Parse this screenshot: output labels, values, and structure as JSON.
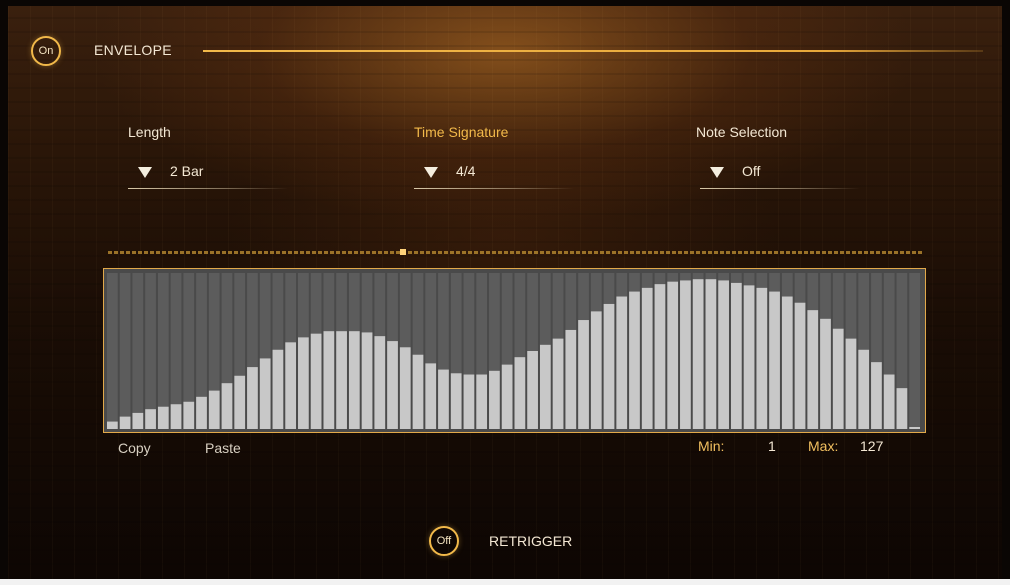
{
  "envelope": {
    "title": "ENVELOPE",
    "power": "On"
  },
  "controls": {
    "length": {
      "label": "Length",
      "value": "2 Bar"
    },
    "time_signature": {
      "label": "Time Signature",
      "value": "4/4"
    },
    "note_selection": {
      "label": "Note Selection",
      "value": "Off"
    }
  },
  "editor": {
    "copy_label": "Copy",
    "paste_label": "Paste",
    "min_label": "Min:",
    "min_value": "1",
    "max_label": "Max:",
    "max_value": "127",
    "current_step": 24,
    "step_count": 64
  },
  "retrigger": {
    "label": "RETRIGGER",
    "state": "Off"
  },
  "colors": {
    "accent": "#f2b94a",
    "bar": "#c8c8c8",
    "graph_bg": "#4a4a4a"
  },
  "chart_data": {
    "type": "bar",
    "y_range": [
      1,
      127
    ],
    "values": [
      7,
      11,
      14,
      17,
      19,
      21,
      23,
      27,
      32,
      38,
      44,
      51,
      58,
      65,
      71,
      75,
      78,
      80,
      80,
      80,
      79,
      76,
      72,
      67,
      61,
      54,
      49,
      46,
      45,
      45,
      48,
      53,
      59,
      64,
      69,
      74,
      81,
      89,
      96,
      102,
      108,
      112,
      115,
      118,
      120,
      121,
      122,
      122,
      121,
      119,
      117,
      115,
      112,
      108,
      103,
      97,
      90,
      82,
      74,
      65,
      55,
      45,
      34,
      2
    ]
  }
}
